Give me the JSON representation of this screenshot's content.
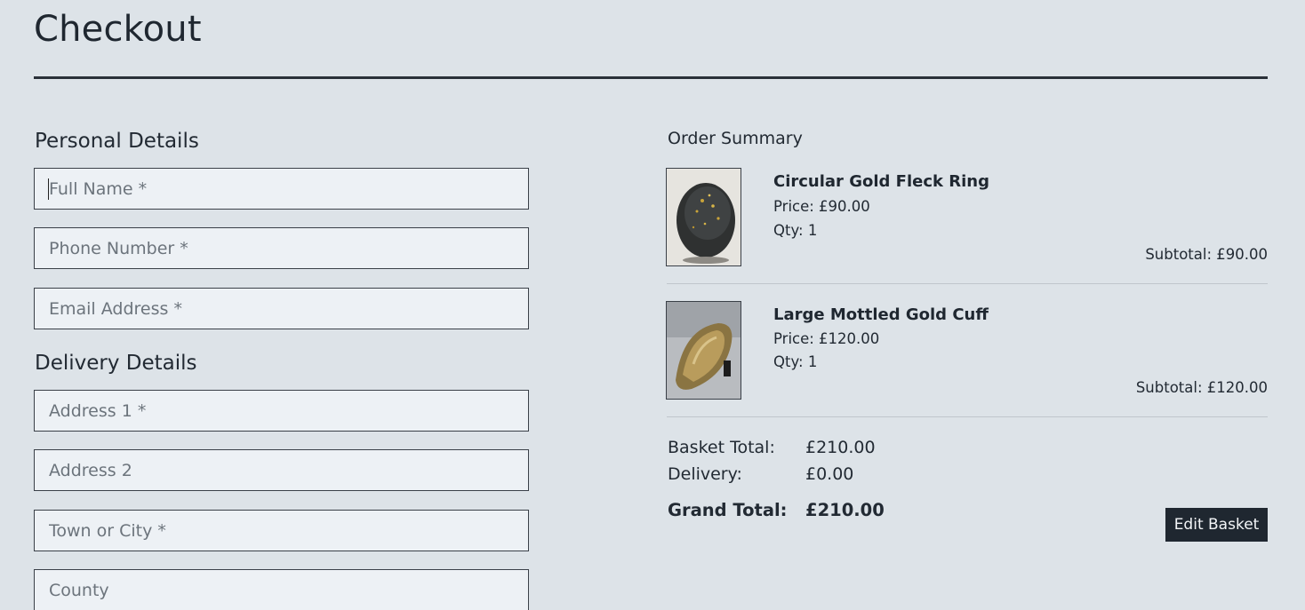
{
  "page": {
    "title": "Checkout"
  },
  "personal_details": {
    "heading": "Personal Details",
    "fields": {
      "full_name": {
        "placeholder": "Full Name *",
        "value": ""
      },
      "phone": {
        "placeholder": "Phone Number *",
        "value": ""
      },
      "email": {
        "placeholder": "Email Address *",
        "value": ""
      }
    }
  },
  "delivery_details": {
    "heading": "Delivery Details",
    "fields": {
      "address1": {
        "placeholder": "Address 1 *",
        "value": ""
      },
      "address2": {
        "placeholder": "Address 2",
        "value": ""
      },
      "town": {
        "placeholder": "Town or City *",
        "value": ""
      },
      "county": {
        "placeholder": "County",
        "value": ""
      }
    }
  },
  "order_summary": {
    "heading": "Order Summary",
    "items": [
      {
        "name": "Circular Gold Fleck Ring",
        "price": "Price: £90.00",
        "qty": "Qty: 1",
        "subtotal": "Subtotal: £90.00"
      },
      {
        "name": "Large Mottled Gold Cuff",
        "price": "Price: £120.00",
        "qty": "Qty: 1",
        "subtotal": "Subtotal: £120.00"
      }
    ],
    "totals": {
      "basket_label": "Basket Total:",
      "basket_value": "£210.00",
      "delivery_label": "Delivery:",
      "delivery_value": "£0.00",
      "grand_label": "Grand Total:",
      "grand_value": "£210.00"
    },
    "edit_button": "Edit Basket"
  },
  "colors": {
    "background": "#dde3e8",
    "field_background": "#edf1f5",
    "button_background": "#1f2730",
    "text": "#222a33"
  }
}
